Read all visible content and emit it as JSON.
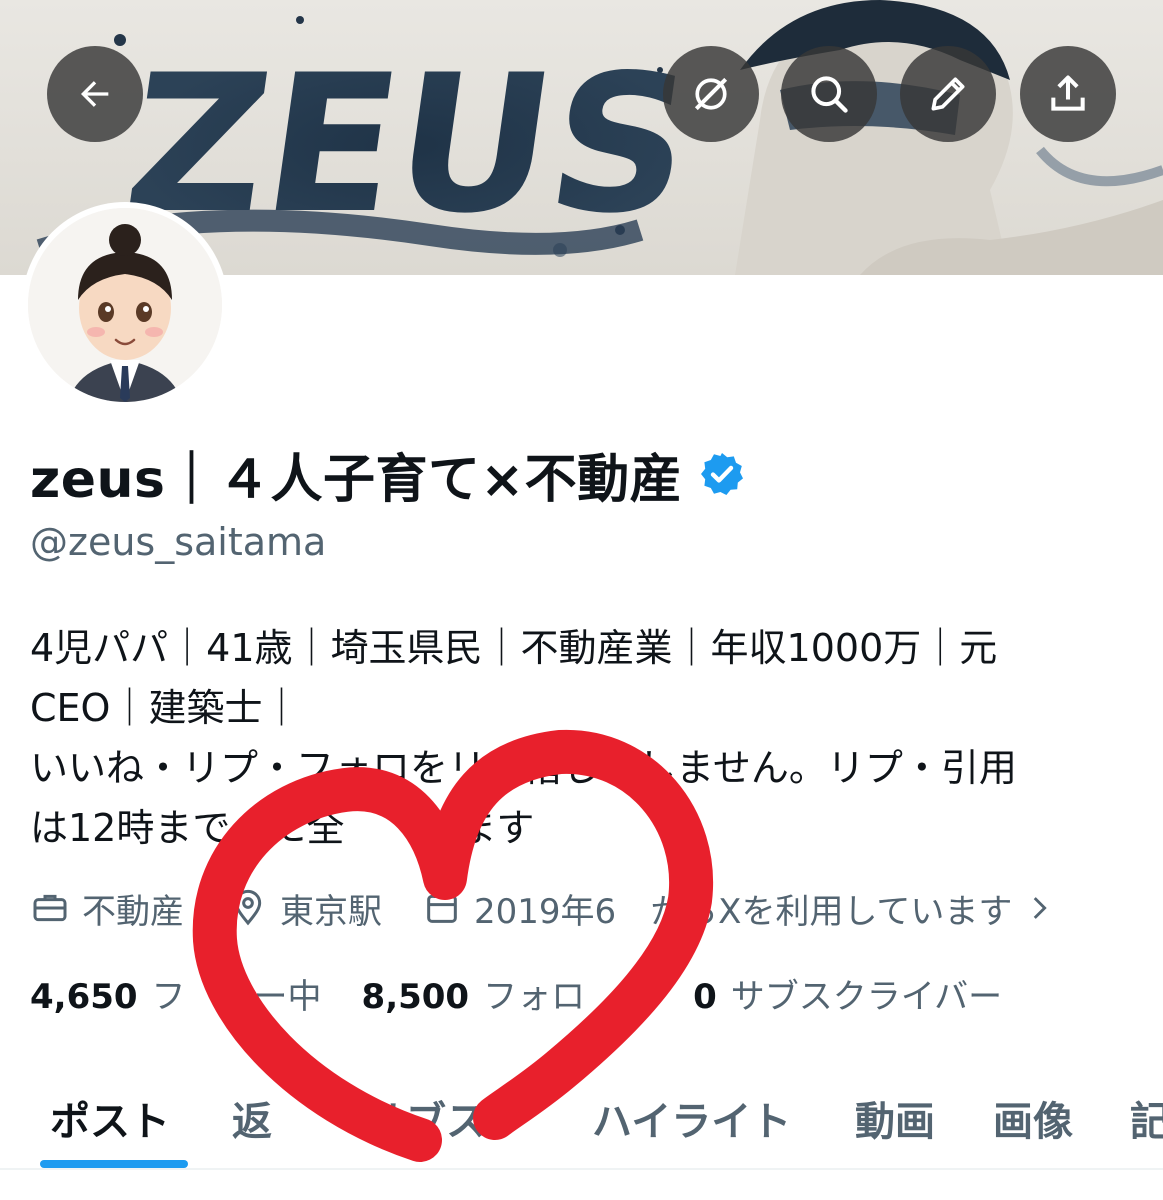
{
  "header": {
    "back_icon": "arrow-left-icon",
    "actions": [
      {
        "icon": "grok-icon"
      },
      {
        "icon": "search-icon"
      },
      {
        "icon": "pencil-icon"
      },
      {
        "icon": "share-icon"
      }
    ],
    "banner_text": "ZEUS"
  },
  "profile": {
    "display_name": "zeus｜４人子育て×不動産",
    "verified_badge_color": "#1d9bf0",
    "handle": "@zeus_saitama",
    "bio_lines": [
      "4児パパ｜41歳｜埼玉県民｜不動産業｜年収1000万｜元",
      "CEO｜建築士｜",
      "いいね・リプ・フォロをリ　惜しみしません。リプ・引用",
      "は12時まで　に全　　します"
    ],
    "category": "不動産",
    "location": "東京駅",
    "joined": "2019年6　からXを利用しています",
    "stats": {
      "following_count": "4,650",
      "following_label": "フ　ロー中",
      "followers_count": "8,500",
      "followers_label": "フォロ　ー",
      "subscribers_count": "0",
      "subscribers_label": "サブスクライバー"
    }
  },
  "tabs": [
    {
      "label": "ポスト",
      "active": true
    },
    {
      "label": "返",
      "active": false
    },
    {
      "label": "サブス",
      "active": false
    },
    {
      "label": "ハイライト",
      "active": false
    },
    {
      "label": "動画",
      "active": false
    },
    {
      "label": "画像",
      "active": false
    },
    {
      "label": "記",
      "active": false
    }
  ],
  "colors": {
    "accent": "#1d9bf0",
    "text_primary": "#0f1419",
    "text_secondary": "#536471",
    "heart_overlay": "#e8202c"
  },
  "overlay": {
    "shape": "heart-scribble"
  }
}
